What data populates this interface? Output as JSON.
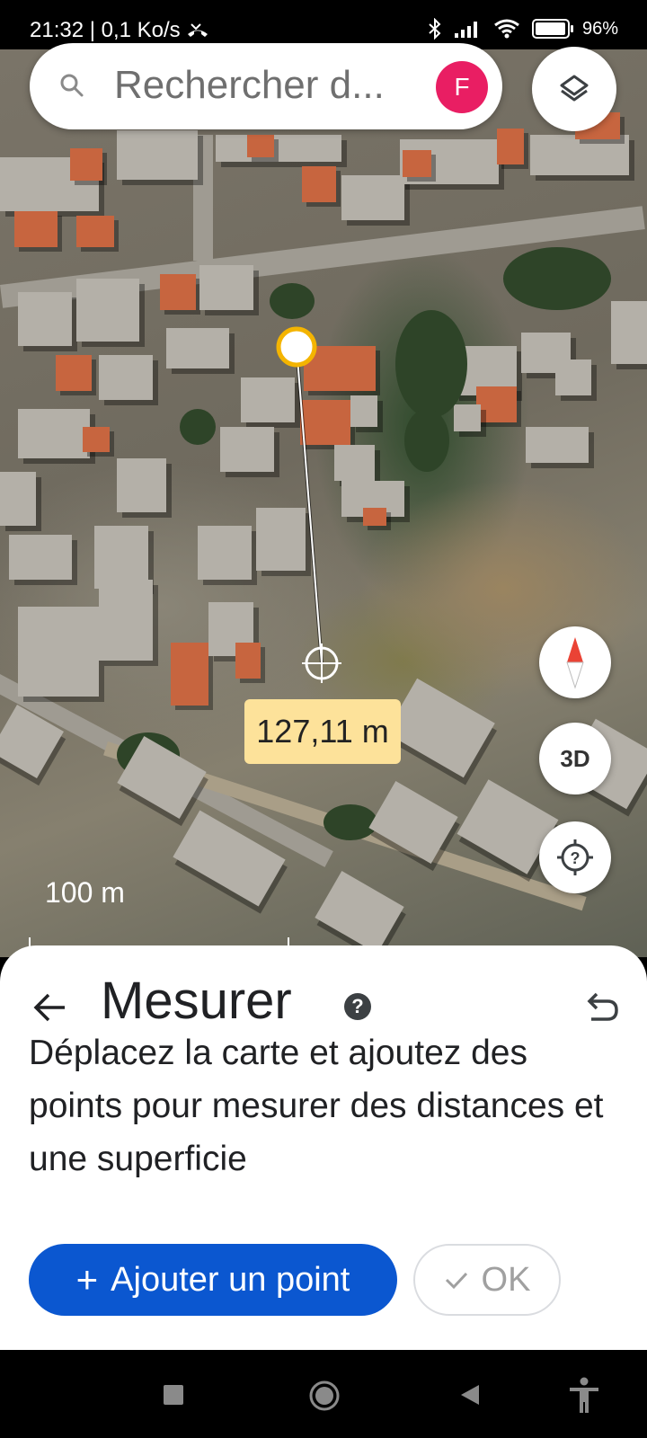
{
  "status_bar": {
    "time_info": "21:32 | 0,1 Ko/s",
    "battery": "96%",
    "battery_level": 0.96
  },
  "search": {
    "placeholder": "Rechercher d...",
    "avatar_initial": "F"
  },
  "map": {
    "distance": "127,11 m",
    "scale_label": "100 m",
    "button_3d": "3D"
  },
  "sheet": {
    "title": "Mesurer",
    "help_symbol": "?",
    "description": "Déplacez la carte et ajoutez des points pour mesurer des distances et une superficie",
    "add_point_label": "Ajouter un point",
    "ok_label": "OK"
  },
  "icons": {
    "search": "search-icon",
    "layers": "layers-icon",
    "compass": "compass-icon",
    "location": "my-location-icon",
    "back": "back-arrow-icon",
    "help": "help-icon",
    "undo": "undo-icon",
    "nav_recent": "square-icon",
    "nav_home": "circle-icon",
    "nav_back": "triangle-icon",
    "accessibility": "accessibility-icon"
  },
  "colors": {
    "accent_blue": "#0b57d0",
    "avatar_pink": "#e91e63",
    "measure_marker": "#f4b400",
    "distance_label_bg": "#fde29a"
  }
}
